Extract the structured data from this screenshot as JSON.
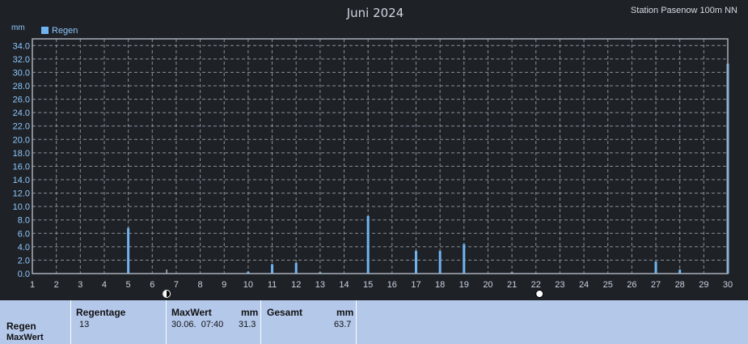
{
  "header": {
    "title": "Juni 2024",
    "station": "Station Pasenow 100m NN",
    "unit": "mm"
  },
  "chart_data": {
    "type": "bar",
    "title": "Juni 2024",
    "ylabel": "mm",
    "ylim": [
      0,
      35
    ],
    "xlim": [
      1,
      30
    ],
    "yticks": [
      "0.0",
      "2.0",
      "4.0",
      "6.0",
      "8.0",
      "10.0",
      "12.0",
      "14.0",
      "16.0",
      "18.0",
      "20.0",
      "22.0",
      "24.0",
      "26.0",
      "28.0",
      "30.0",
      "32.0",
      "34.0"
    ],
    "xticks": [
      "1",
      "2",
      "3",
      "4",
      "5",
      "6",
      "7",
      "8",
      "9",
      "10",
      "11",
      "12",
      "13",
      "14",
      "15",
      "16",
      "17",
      "18",
      "19",
      "20",
      "21",
      "22",
      "23",
      "24",
      "25",
      "26",
      "27",
      "28",
      "29",
      "30"
    ],
    "grid": true,
    "legend_position": "top-left",
    "series": [
      {
        "name": "Regen",
        "color": "#6fb4f0",
        "x": [
          5,
          10,
          11,
          12,
          13,
          15,
          17,
          18,
          19,
          21,
          22,
          27,
          28,
          30
        ],
        "values": [
          6.8,
          0.3,
          1.4,
          1.6,
          0.2,
          8.6,
          3.4,
          3.4,
          4.4,
          0.2,
          0.1,
          1.8,
          0.6,
          31.3
        ]
      }
    ],
    "moon_phases": [
      {
        "day": 6.6,
        "phase": "first-quarter"
      },
      {
        "day": 22.15,
        "phase": "full-moon"
      }
    ],
    "marker_day": 6.6
  },
  "summary": {
    "row_label_1": "Regen",
    "row_label_2": "MaxWert",
    "regentage_label": "Regentage",
    "regentage_value": "13",
    "maxwert_label": "MaxWert",
    "maxwert_unit": "mm",
    "maxwert_date": "30.06.  07:40",
    "maxwert_value": "31.3",
    "gesamt_label": "Gesamt",
    "gesamt_unit": "mm",
    "gesamt_value": "63.7"
  }
}
